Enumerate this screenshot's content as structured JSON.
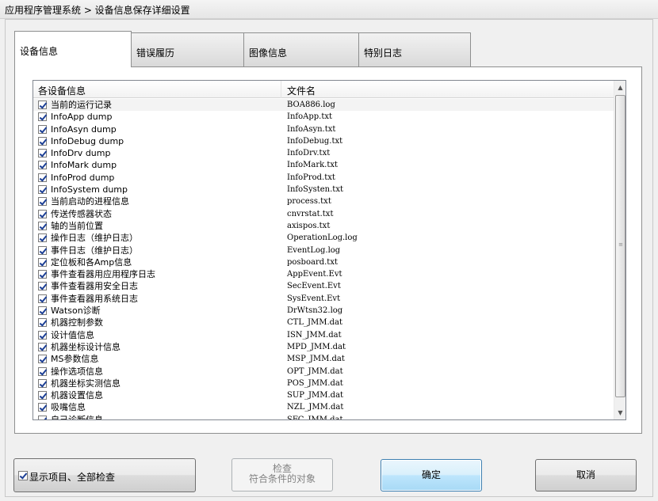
{
  "window": {
    "title": "应用程序管理系统 > 设备信息保存详细设置"
  },
  "tabs": [
    {
      "label": "设备信息",
      "active": true
    },
    {
      "label": "错误履历",
      "active": false
    },
    {
      "label": "图像信息",
      "active": false
    },
    {
      "label": "特别日志",
      "active": false
    }
  ],
  "list": {
    "columns": [
      "各设备信息",
      "文件名"
    ],
    "rows": [
      {
        "name": "当前的运行记录",
        "file": "BOA886.log",
        "checked": true
      },
      {
        "name": "InfoApp dump",
        "file": "InfoApp.txt",
        "checked": true
      },
      {
        "name": "InfoAsyn dump",
        "file": "InfoAsyn.txt",
        "checked": true
      },
      {
        "name": "InfoDebug dump",
        "file": "InfoDebug.txt",
        "checked": true
      },
      {
        "name": "InfoDrv dump",
        "file": "InfoDrv.txt",
        "checked": true
      },
      {
        "name": "InfoMark dump",
        "file": "InfoMark.txt",
        "checked": true
      },
      {
        "name": "InfoProd dump",
        "file": "InfoProd.txt",
        "checked": true
      },
      {
        "name": "InfoSystem dump",
        "file": "InfoSysten.txt",
        "checked": true
      },
      {
        "name": "当前启动的进程信息",
        "file": "process.txt",
        "checked": true
      },
      {
        "name": "传送传感器状态",
        "file": "cnvrstat.txt",
        "checked": true
      },
      {
        "name": "轴的当前位置",
        "file": "axispos.txt",
        "checked": true
      },
      {
        "name": "操作日志（维护日志）",
        "file": "OperationLog.log",
        "checked": true
      },
      {
        "name": "事件日志（维护日志）",
        "file": "EventLog.log",
        "checked": true
      },
      {
        "name": "定位板和各Amp信息",
        "file": "posboard.txt",
        "checked": true
      },
      {
        "name": "事件查看器用应用程序日志",
        "file": "AppEvent.Evt",
        "checked": true
      },
      {
        "name": "事件查看器用安全日志",
        "file": "SecEvent.Evt",
        "checked": true
      },
      {
        "name": "事件查看器用系统日志",
        "file": "SysEvent.Evt",
        "checked": true
      },
      {
        "name": " Watson诊断",
        "file": "DrWtsn32.log",
        "checked": true
      },
      {
        "name": "机器控制参数",
        "file": "CTL_JMM.dat",
        "checked": true
      },
      {
        "name": "设计值信息",
        "file": "ISN_JMM.dat",
        "checked": true
      },
      {
        "name": "机器坐标设计信息",
        "file": "MPD_JMM.dat",
        "checked": true
      },
      {
        "name": "MS参数信息",
        "file": "MSP_JMM.dat",
        "checked": true
      },
      {
        "name": "操作选项信息",
        "file": "OPT_JMM.dat",
        "checked": true
      },
      {
        "name": "机器坐标实测信息",
        "file": "POS_JMM.dat",
        "checked": true
      },
      {
        "name": "机器设置信息",
        "file": "SUP_JMM.dat",
        "checked": true
      },
      {
        "name": "吸嘴信息",
        "file": "NZL_JMM.dat",
        "checked": true
      },
      {
        "name": "自己诊断信息",
        "file": "SFC_JMM.dat",
        "checked": true
      }
    ]
  },
  "buttons": {
    "show_all": "显示项目、全部检查",
    "check_line1": "检查",
    "check_line2": "符合条件的对象",
    "ok": "确定",
    "cancel": "取消"
  },
  "icons": {
    "scroll_up": "scroll-up-arrow-icon",
    "scroll_down": "scroll-down-arrow-icon",
    "checkbox": "checkbox-checked-icon"
  }
}
